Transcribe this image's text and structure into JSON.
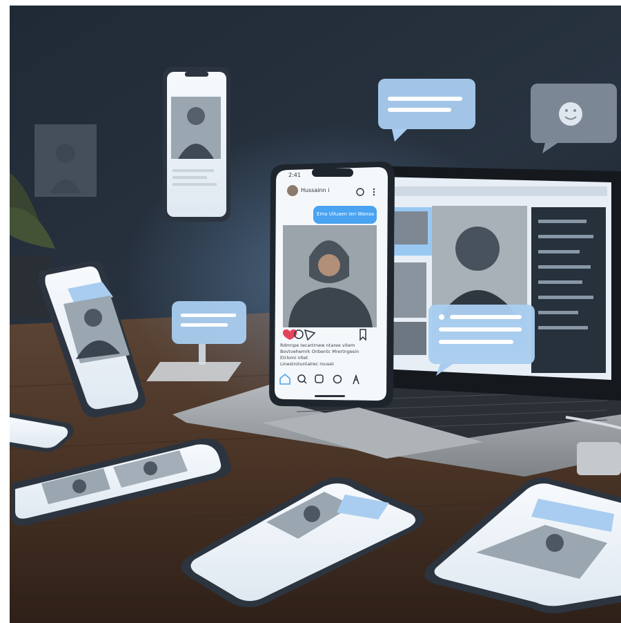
{
  "colors": {
    "wall": "#1f2833",
    "table": "#4a3426",
    "screen": "#f4f7fb",
    "bubble": "#b9d7f2",
    "accent": "#4aa3f0",
    "laptop": "#9ea3a8"
  },
  "hero_phone": {
    "status_time": "2:41",
    "username": "Hussainn i",
    "message_bubble": "Ema Ulluaen ien Wanaa",
    "caption_lines": [
      "Rdmnpe tecartrnew ntaree vitem",
      "Bovtvehemrk Onbentc Mrertngesin",
      "Etrlomi nltet",
      "Linestrotuntalrec rouset"
    ],
    "action_icons": [
      "heart-icon",
      "comment-icon",
      "share-icon",
      "bookmark-icon"
    ],
    "nav_icons": [
      "home-icon",
      "search-icon",
      "reels-icon",
      "shop-icon",
      "profile-icon"
    ]
  },
  "laptop": {
    "icons": [
      "emoji-icon"
    ]
  }
}
